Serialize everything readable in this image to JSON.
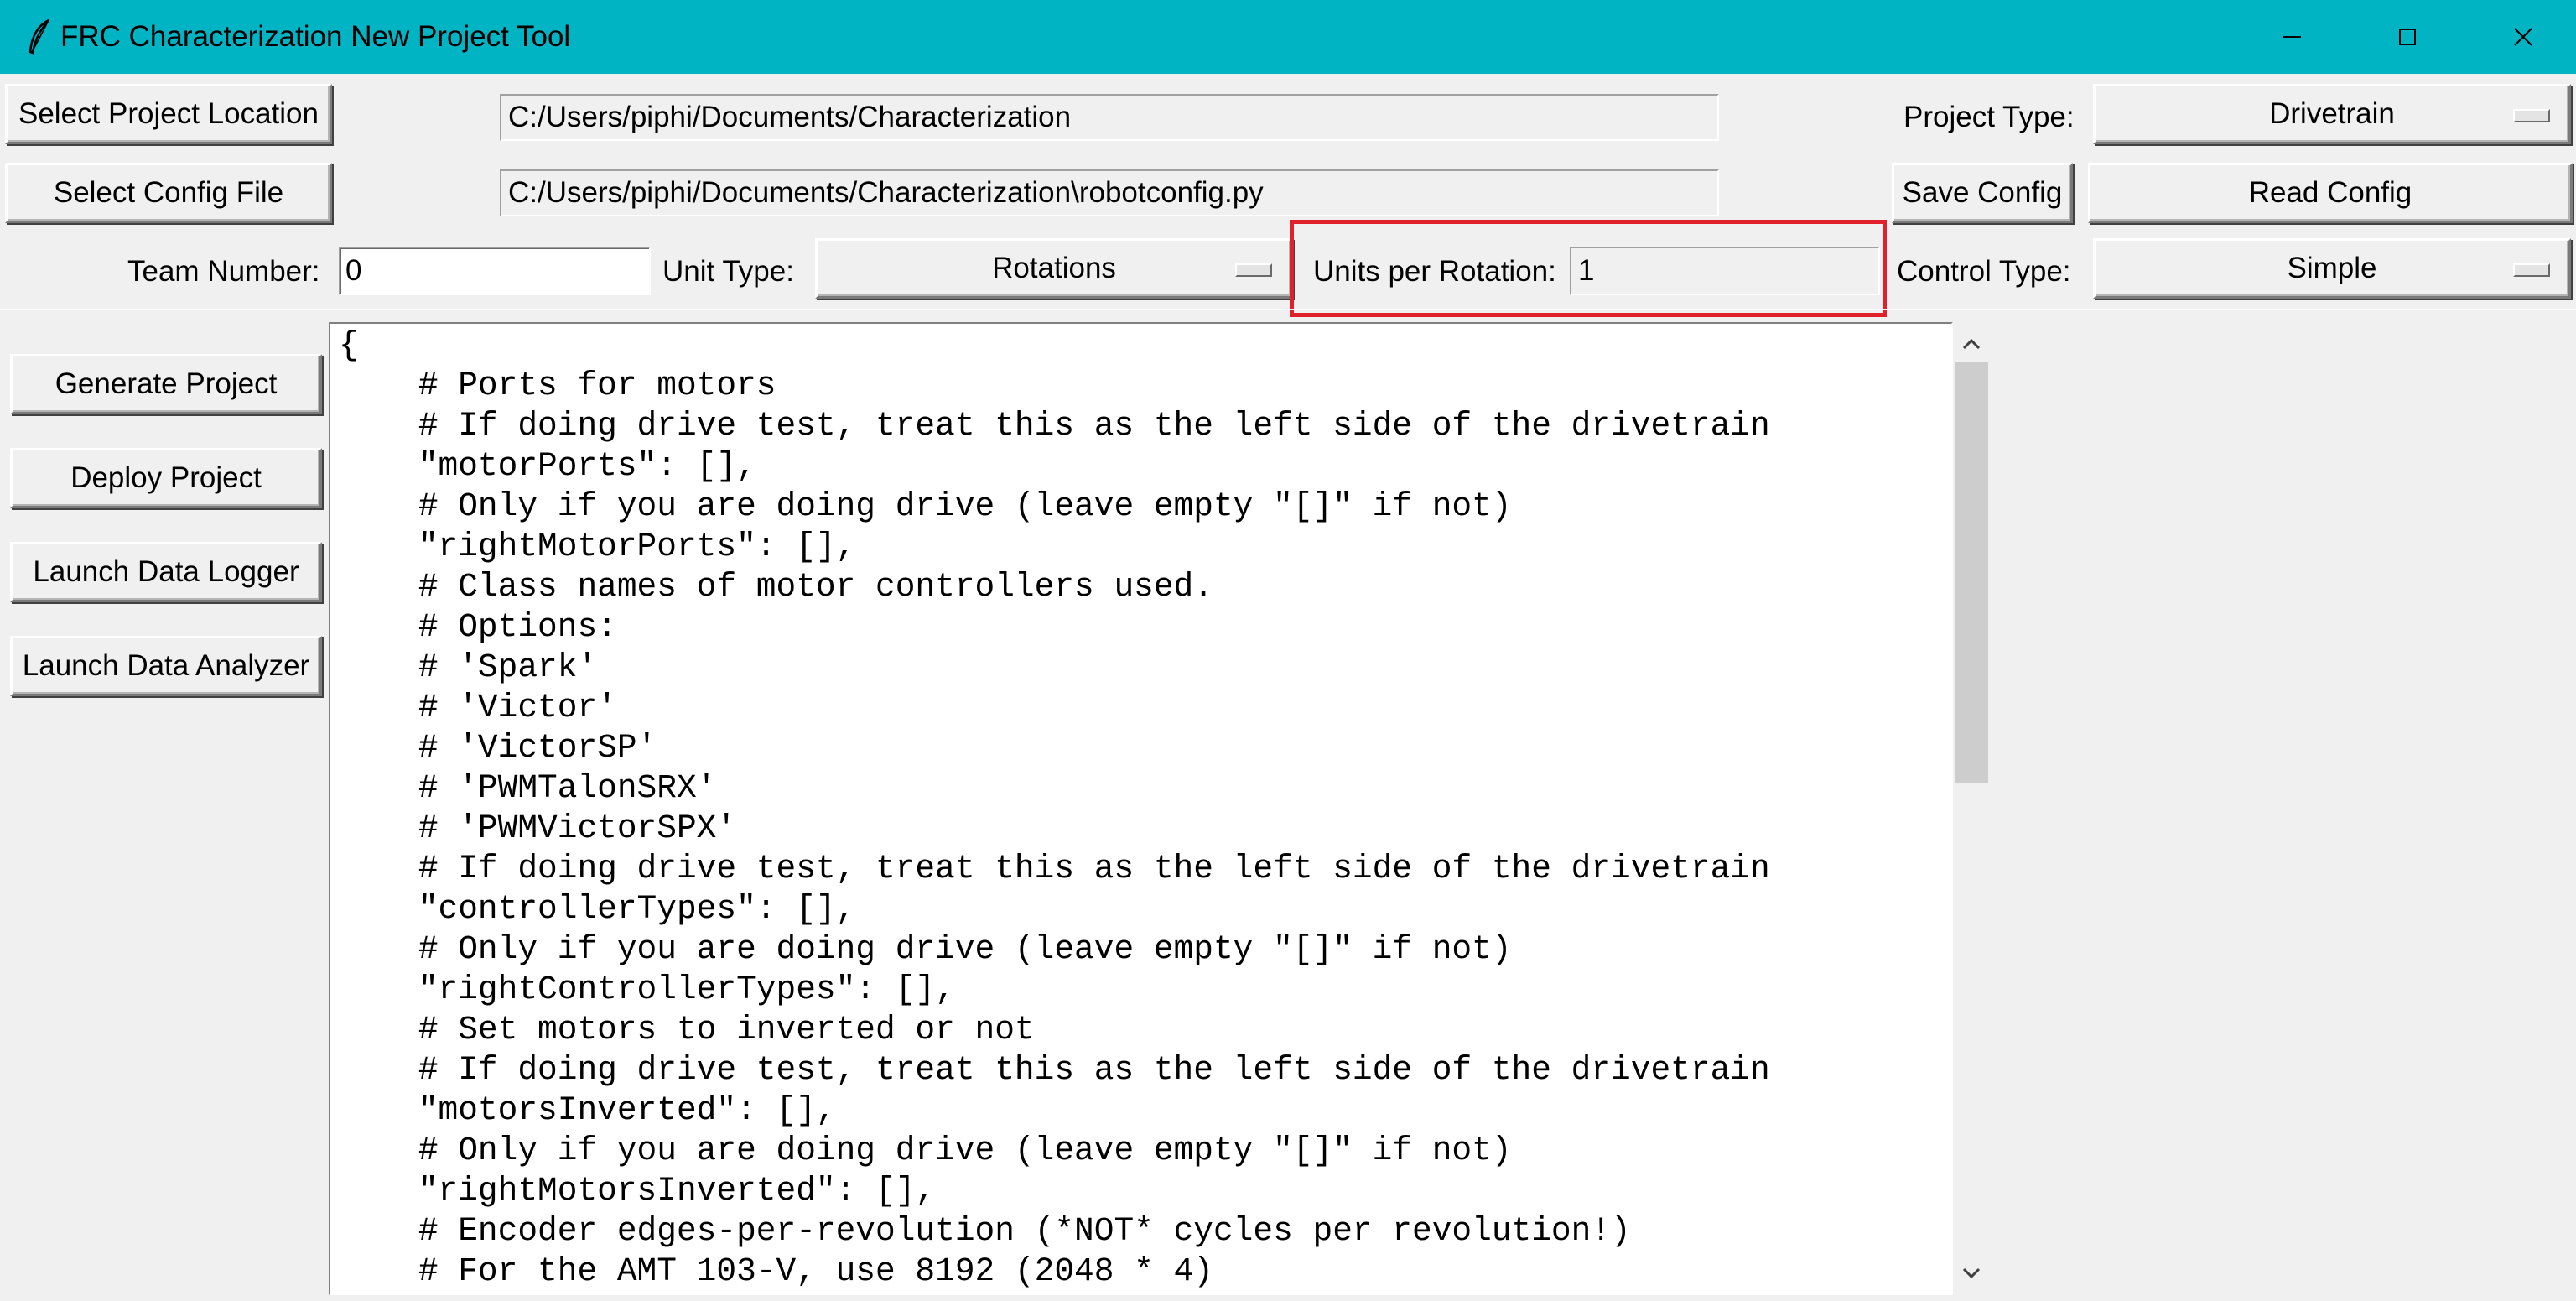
{
  "window": {
    "title": "FRC Characterization New Project Tool",
    "app_icon": "feather-icon",
    "title_bar_color": "#00b4c3"
  },
  "toolbar": {
    "select_project_location_label": "Select Project Location",
    "project_location_value": "C:/Users/piphi/Documents/Characterization",
    "project_type_label": "Project Type:",
    "project_type_value": "Drivetrain",
    "select_config_file_label": "Select Config File",
    "config_file_value": "C:/Users/piphi/Documents/Characterization\\robotconfig.py",
    "save_config_label": "Save Config",
    "read_config_label": "Read Config",
    "team_number_label": "Team Number:",
    "team_number_value": "0",
    "unit_type_label": "Unit Type:",
    "unit_type_value": "Rotations",
    "units_per_rotation_label": "Units per Rotation:",
    "units_per_rotation_value": "1",
    "control_type_label": "Control Type:",
    "control_type_value": "Simple"
  },
  "sidebar": {
    "generate_project_label": "Generate Project",
    "deploy_project_label": "Deploy Project",
    "launch_data_logger_label": "Launch Data Logger",
    "launch_data_analyzer_label": "Launch Data Analyzer"
  },
  "highlight_color": "#e0202a",
  "config_text": "{\n    # Ports for motors\n    # If doing drive test, treat this as the left side of the drivetrain\n    \"motorPorts\": [],\n    # Only if you are doing drive (leave empty \"[]\" if not)\n    \"rightMotorPorts\": [],\n    # Class names of motor controllers used.\n    # Options:\n    # 'Spark'\n    # 'Victor'\n    # 'VictorSP'\n    # 'PWMTalonSRX'\n    # 'PWMVictorSPX'\n    # If doing drive test, treat this as the left side of the drivetrain\n    \"controllerTypes\": [],\n    # Only if you are doing drive (leave empty \"[]\" if not)\n    \"rightControllerTypes\": [],\n    # Set motors to inverted or not\n    # If doing drive test, treat this as the left side of the drivetrain\n    \"motorsInverted\": [],\n    # Only if you are doing drive (leave empty \"[]\" if not)\n    \"rightMotorsInverted\": [],\n    # Encoder edges-per-revolution (*NOT* cycles per revolution!)\n    # For the AMT 103-V, use 8192 (2048 * 4)"
}
